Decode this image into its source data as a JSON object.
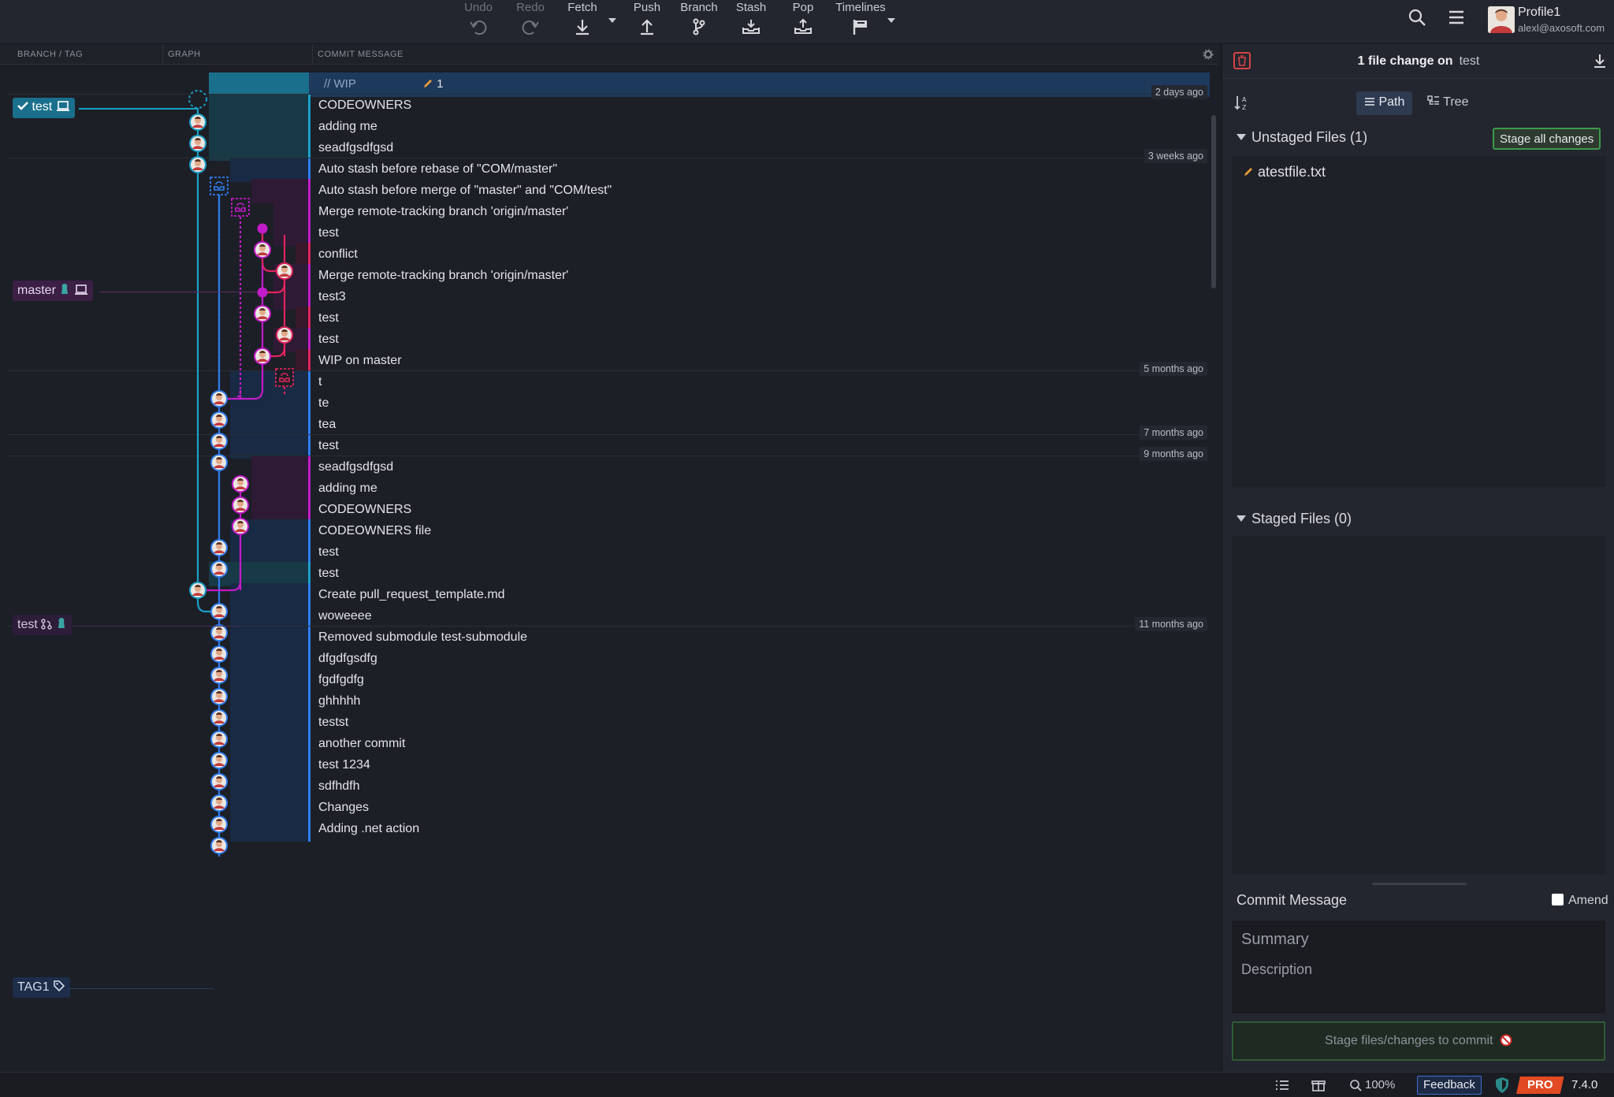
{
  "toolbar": {
    "undo": "Undo",
    "redo": "Redo",
    "fetch": "Fetch",
    "push": "Push",
    "branch": "Branch",
    "stash": "Stash",
    "pop": "Pop",
    "timelines": "Timelines"
  },
  "profile": {
    "name": "Profile1",
    "email": "alexl@axosoft.com"
  },
  "columns": {
    "branch_tag": "BRANCH / TAG",
    "graph": "GRAPH",
    "commit_message": "COMMIT MESSAGE"
  },
  "wip": {
    "label": "// WIP",
    "count": "1"
  },
  "refs": {
    "test_head": "test",
    "master": "master",
    "test_remote": "test",
    "tag1": "TAG1"
  },
  "timestamps": [
    "2 days ago",
    "3 weeks ago",
    "5 months ago",
    "7 months ago",
    "9 months ago",
    "11 months ago"
  ],
  "commits": [
    "CODEOWNERS",
    "adding me",
    "seadfgsdfgsd",
    "Auto stash before rebase of \"COM/master\"",
    "Auto stash before merge of \"master\" and \"COM/test\"",
    "Merge remote-tracking branch 'origin/master'",
    "test",
    "conflict",
    "Merge remote-tracking branch 'origin/master'",
    "test3",
    "test",
    "test",
    "WIP on master",
    "t",
    "te",
    "tea",
    "test",
    "seadfgsdfgsd",
    "adding me",
    "CODEOWNERS",
    "CODEOWNERS file",
    "test",
    "test",
    "Create pull_request_template.md",
    "woweeee",
    "Removed submodule test-submodule",
    "dfgdfgsdfg",
    "fgdfgdfg",
    "ghhhhh",
    "testst",
    "another commit",
    "test 1234",
    "sdfhdfh",
    "Changes",
    "Adding .net action"
  ],
  "right_panel": {
    "title_prefix": "1 file change on",
    "branch": "test",
    "path_label": "Path",
    "tree_label": "Tree",
    "unstaged_header": "Unstaged Files (1)",
    "stage_all": "Stage all changes",
    "unstaged_file": "atestfile.txt",
    "staged_header": "Staged Files (0)",
    "commit_message_label": "Commit Message",
    "amend_label": "Amend",
    "summary_placeholder": "Summary",
    "description_placeholder": "Description",
    "commit_button": "Stage files/changes to commit"
  },
  "statusbar": {
    "zoom": "100%",
    "feedback": "Feedback",
    "pro": "PRO",
    "version": "7.4.0"
  },
  "colors": {
    "cyan": "#1aa0c8",
    "blue": "#2f7df0",
    "magenta": "#c21bc9",
    "pink": "#e0245e",
    "accent_green": "#3d9a4b"
  }
}
